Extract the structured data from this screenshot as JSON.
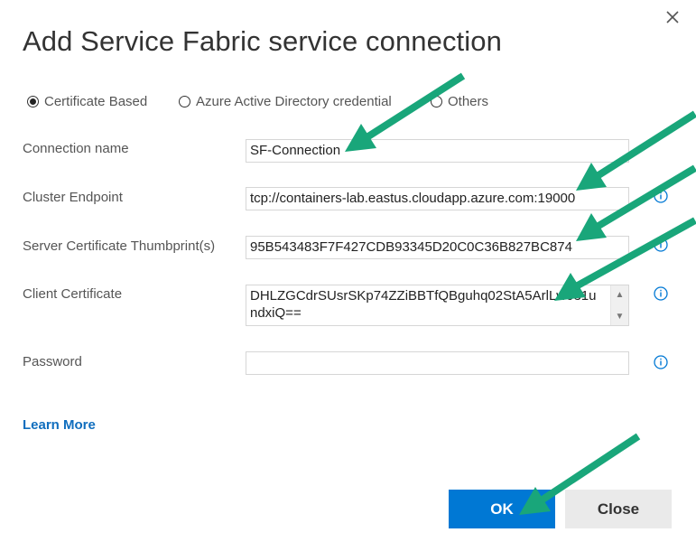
{
  "dialog": {
    "title": "Add Service Fabric service connection",
    "close_icon": "close-icon"
  },
  "auth_type": {
    "options": [
      {
        "label": "Certificate Based",
        "checked": true
      },
      {
        "label": "Azure Active Directory credential",
        "checked": false
      },
      {
        "label": "Others",
        "checked": false
      }
    ]
  },
  "form": {
    "connection_name": {
      "label": "Connection name",
      "value": "SF-Connection"
    },
    "cluster_endpoint": {
      "label": "Cluster Endpoint",
      "value": "tcp://containers-lab.eastus.cloudapp.azure.com:19000"
    },
    "server_thumbprint": {
      "label": "Server Certificate Thumbprint(s)",
      "value": "95B543483F7F427CDB93345D20C0C36B827BC874"
    },
    "client_certificate": {
      "label": "Client Certificate",
      "value": "DHLZGCdrSUsrSKp74ZZiBBTfQBguhq02StA5ArlLw031undxiQ=="
    },
    "password": {
      "label": "Password",
      "value": ""
    }
  },
  "learn_more": "Learn More",
  "buttons": {
    "ok": "OK",
    "close": "Close"
  },
  "colors": {
    "accent": "#0078d4",
    "link": "#106ebe",
    "annotation_arrow": "#19a67a"
  },
  "icons": {
    "info": "info-icon",
    "close": "close-icon"
  }
}
